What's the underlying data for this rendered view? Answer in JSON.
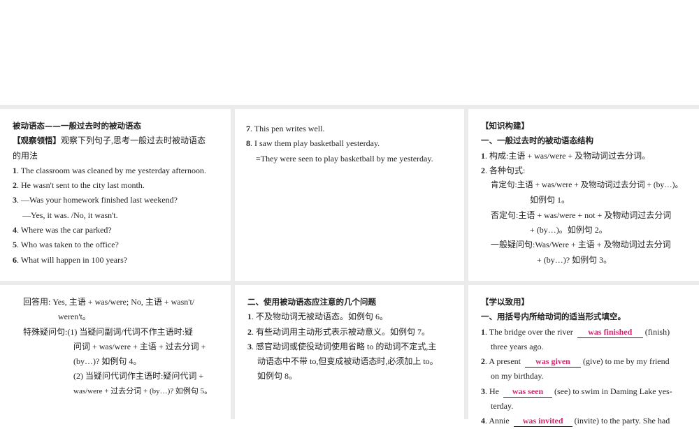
{
  "p1": {
    "title": "被动语态——一般过去时的被动语态",
    "tag": "【观察领悟】",
    "intro": "观察下列句子,思考一般过去时被动语态",
    "intro2": "的用法",
    "items": [
      "1",
      "The classroom was cleaned by me yesterday afternoon.",
      "2",
      "He wasn't sent to the city last month.",
      "3",
      "—Was your homework finished last weekend?",
      "—Yes, it was. /No, it wasn't.",
      "4",
      "Where was the car parked?",
      "5",
      "Who was taken to the office?",
      "6",
      "What will happen in 100 years?"
    ]
  },
  "p2": {
    "items": [
      "7",
      "This pen writes well.",
      "8",
      "I saw them play basketball yesterday.",
      "=They were seen to play basketball by me yesterday."
    ]
  },
  "p3": {
    "tag": "【知识构建】",
    "heading": "一、一般过去时的被动语态结构",
    "l1n": "1",
    "l1": "构成:主语 + was/were + 及物动词过去分词。",
    "l2n": "2",
    "l2": "各种句式:",
    "a1": "肯定句:主语 + was/were + 及物动词过去分词 + (by…)。",
    "a2": "如例句 1。",
    "b1": "否定句:主语 + was/were + not + 及物动词过去分词",
    "b2": "+ (by…)。如例句 2。",
    "c1": "一般疑问句:Was/Were + 主语 + 及物动词过去分词",
    "c2": "+ (by…)? 如例句 3。"
  },
  "p4": {
    "a1": "回答用: Yes, 主语 + was/were; No, 主语 + wasn't/",
    "a2": "weren't。",
    "b1": "特殊疑问句:(1) 当疑问副词/代词不作主语时:疑",
    "b2": "问词 + was/were + 主语 + 过去分词 +",
    "b3": "(by…)? 如例句 4。",
    "b4": "(2) 当疑问代词作主语时:疑问代词 +",
    "b5": "was/were + 过去分词 + (by…)? 如例句 5。"
  },
  "p5": {
    "heading": "二、使用被动语态应注意的几个问题",
    "n1": "1",
    "l1": "不及物动词无被动语态。如例句 6。",
    "n2": "2",
    "l2": "有些动词用主动形式表示被动意义。如例句 7。",
    "n3": "3",
    "l3a": "感官动词或使役动词使用省略 to 的动词不定式,主",
    "l3b": "动语态中不带 to,但变成被动语态时,必须加上 to。",
    "l3c": "如例句 8。"
  },
  "p6": {
    "tag": "【学以致用】",
    "heading": "一、用括号内所给动词的适当形式填空。",
    "q1n": "1",
    "q1a": "The bridge over the river",
    "q1ans": "was finished",
    "q1b": "(finish)",
    "q1c": "three years ago.",
    "q2n": "2",
    "q2a": "A present",
    "q2ans": "was given",
    "q2b": "(give) to me by my friend",
    "q2c": "on my birthday.",
    "q3n": "3",
    "q3a": "He",
    "q3ans": "was seen",
    "q3b": "(see) to swim in Daming Lake yes-",
    "q3c": "terday.",
    "q4n": "4",
    "q4a": "Annie",
    "q4ans": "was invited",
    "q4b": "(invite) to the party. She had"
  },
  "colors": {
    "answer": "#d6246e",
    "gap": "#ebebeb"
  }
}
